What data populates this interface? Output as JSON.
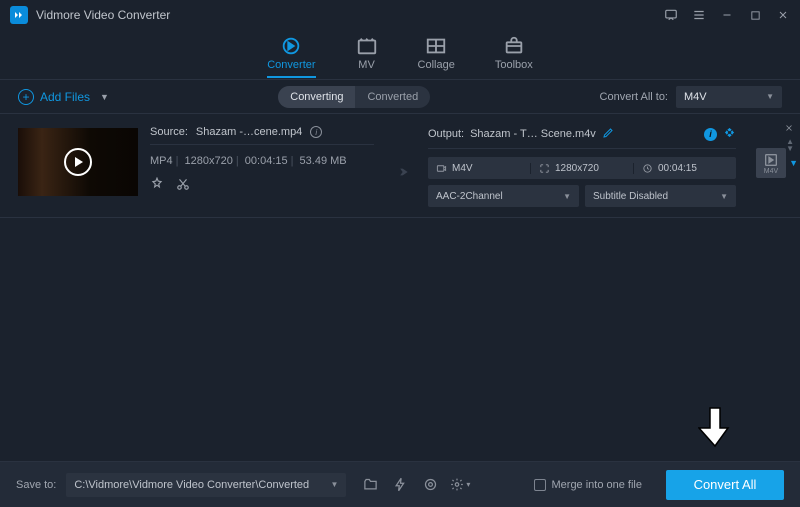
{
  "app": {
    "title": "Vidmore Video Converter"
  },
  "main_tabs": [
    {
      "label": "Converter",
      "active": true
    },
    {
      "label": "MV",
      "active": false
    },
    {
      "label": "Collage",
      "active": false
    },
    {
      "label": "Toolbox",
      "active": false
    }
  ],
  "toolbar": {
    "add_files": "Add Files",
    "seg_converting": "Converting",
    "seg_converted": "Converted",
    "convert_all_to_label": "Convert All to:",
    "convert_all_to_value": "M4V"
  },
  "item": {
    "source_label": "Source:",
    "source_name": "Shazam -…cene.mp4",
    "meta_format": "MP4",
    "meta_res": "1280x720",
    "meta_dur": "00:04:15",
    "meta_size": "53.49 MB",
    "output_label": "Output:",
    "output_name": "Shazam - T… Scene.m4v",
    "out_format": "M4V",
    "out_res": "1280x720",
    "out_dur": "00:04:15",
    "audio_sel": "AAC-2Channel",
    "subtitle_sel": "Subtitle Disabled",
    "fmt_thumb": "M4V"
  },
  "bottom": {
    "save_to_label": "Save to:",
    "save_path": "C:\\Vidmore\\Vidmore Video Converter\\Converted",
    "merge_label": "Merge into one file",
    "convert_all": "Convert All"
  }
}
